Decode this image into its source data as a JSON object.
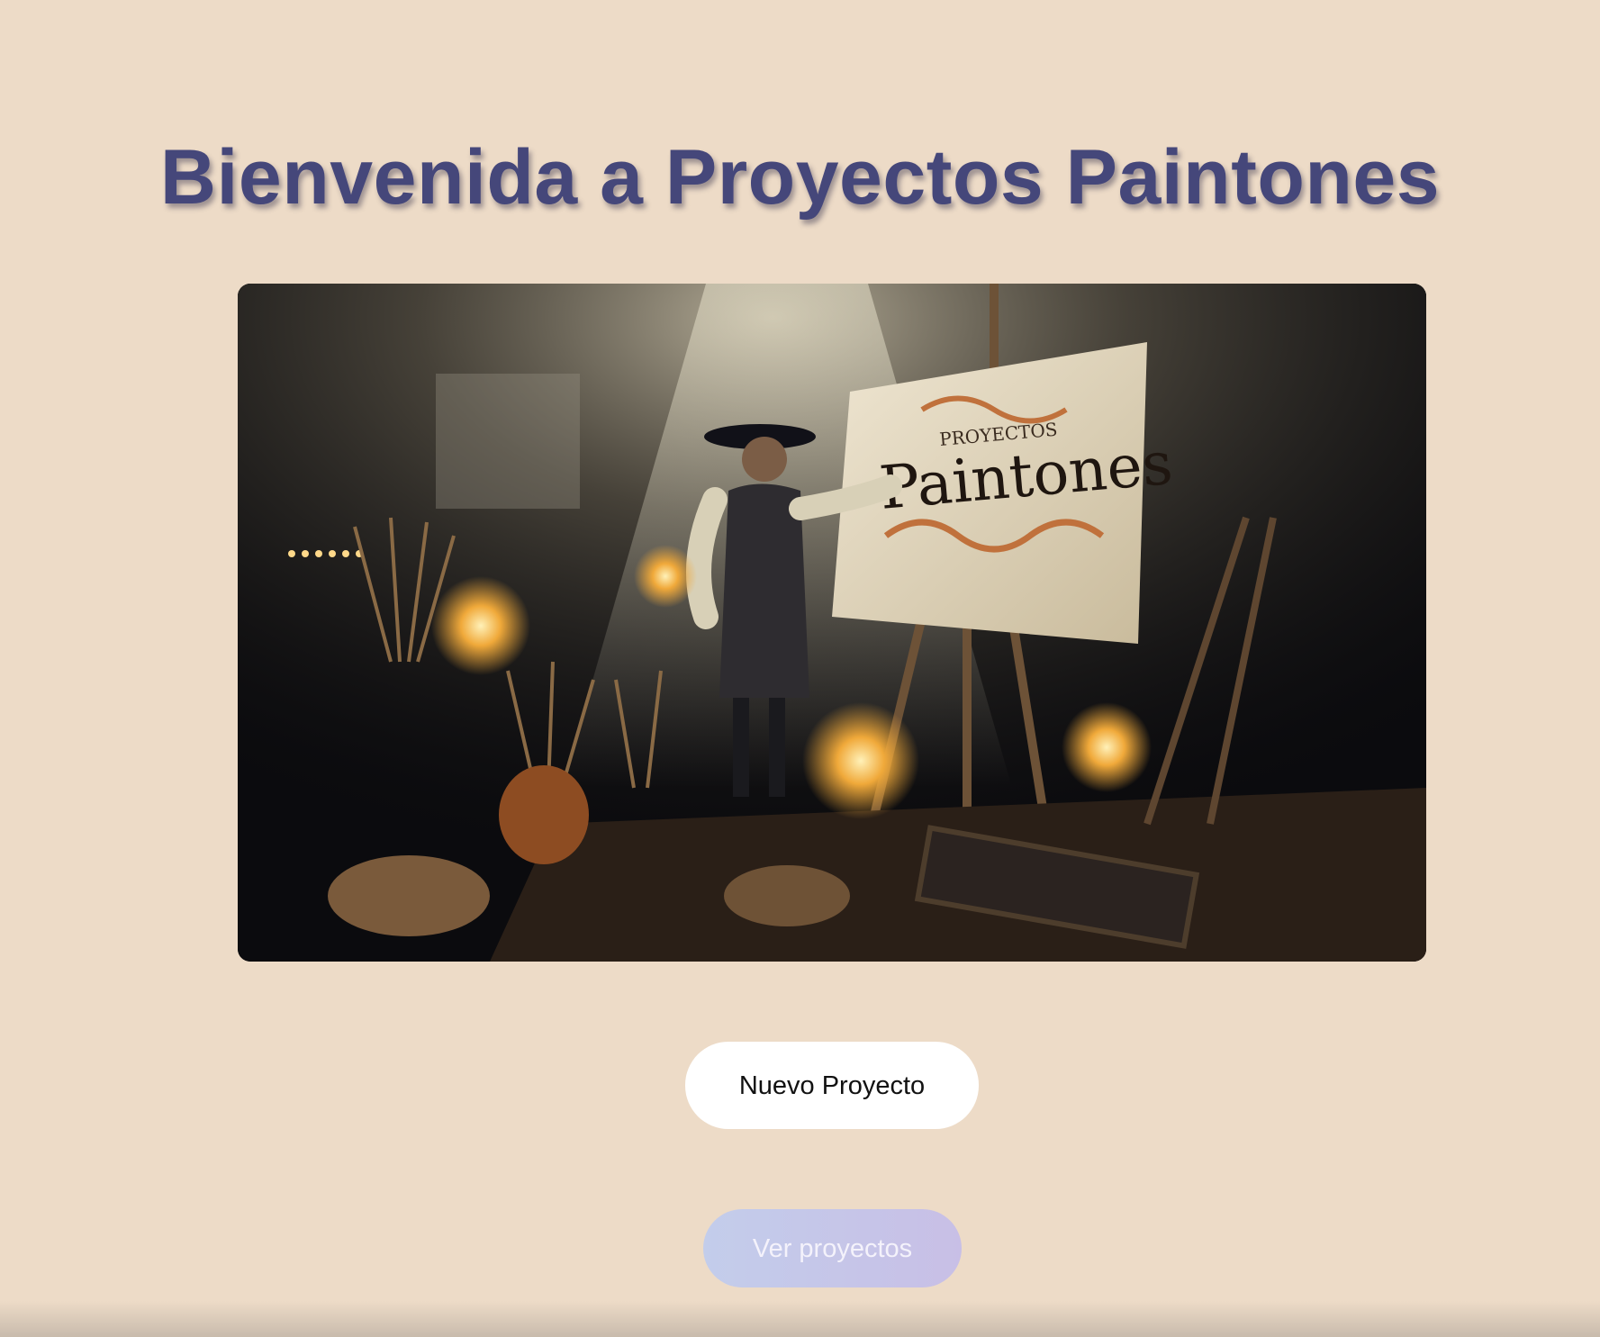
{
  "page": {
    "title": "Bienvenida a Proyectos Paintones",
    "background_color": "#eddbc7",
    "title_color": "#45477a"
  },
  "hero_image": {
    "canvas_small_text": "PROYECTOS",
    "canvas_large_text": "Paintones"
  },
  "actions": {
    "new_project_label": "Nuevo Proyecto",
    "view_projects_label": "Ver proyectos"
  }
}
